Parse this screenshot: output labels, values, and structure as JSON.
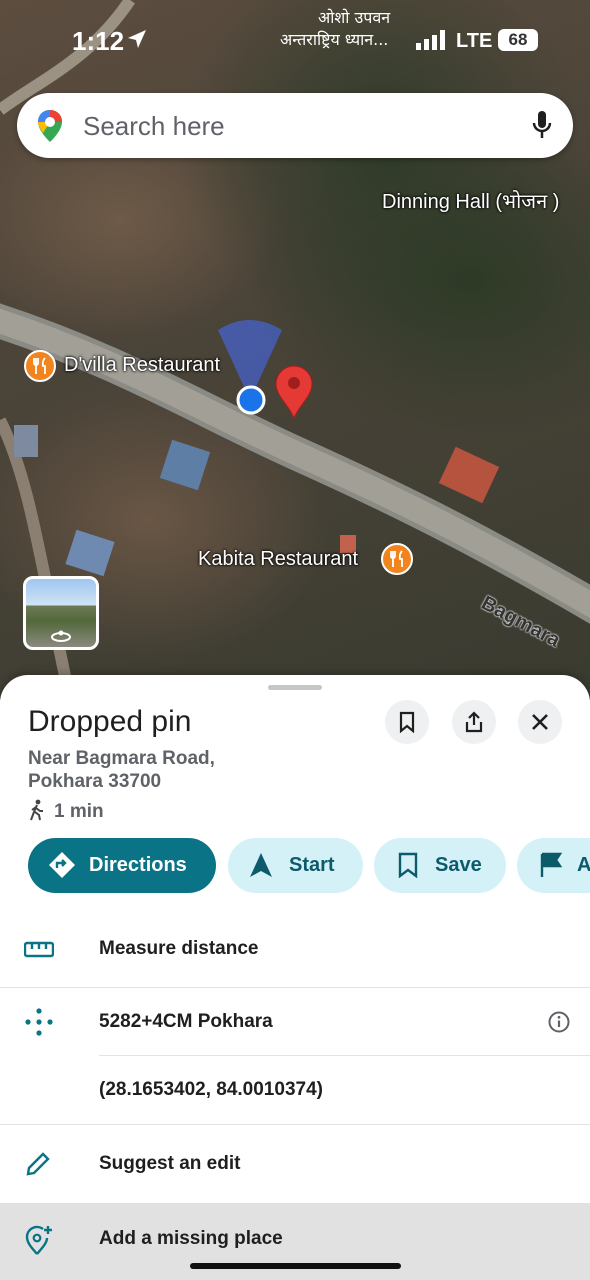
{
  "status": {
    "time": "1:12",
    "carrier_label_1": "ओशो उपवन",
    "carrier_label_2": "अन्तराष्ट्रिय ध्यान...",
    "network": "LTE",
    "battery": "68"
  },
  "search": {
    "placeholder": "Search here"
  },
  "map": {
    "labels": {
      "dinning_hall": "Dinning Hall (भोजन )",
      "dvilla": "D'villa Restaurant",
      "kabita": "Kabita Restaurant",
      "road": "Bagmara"
    }
  },
  "place": {
    "title": "Dropped pin",
    "address_line1": "Near Bagmara Road,",
    "address_line2": "Pokhara 33700",
    "walk_time": "1 min"
  },
  "actions": {
    "directions": "Directions",
    "start": "Start",
    "save": "Save",
    "more": "A"
  },
  "details": {
    "measure": "Measure distance",
    "plus_code": "5282+4CM Pokhara",
    "coordinates": "(28.1653402, 84.0010374)",
    "suggest_edit": "Suggest an edit",
    "add_place": "Add a missing place"
  },
  "colors": {
    "accent": "#0a7385",
    "chip": "#d5f1f8",
    "pin": "#e53935",
    "location": "#1a73e8",
    "poi": "#f0851f"
  }
}
